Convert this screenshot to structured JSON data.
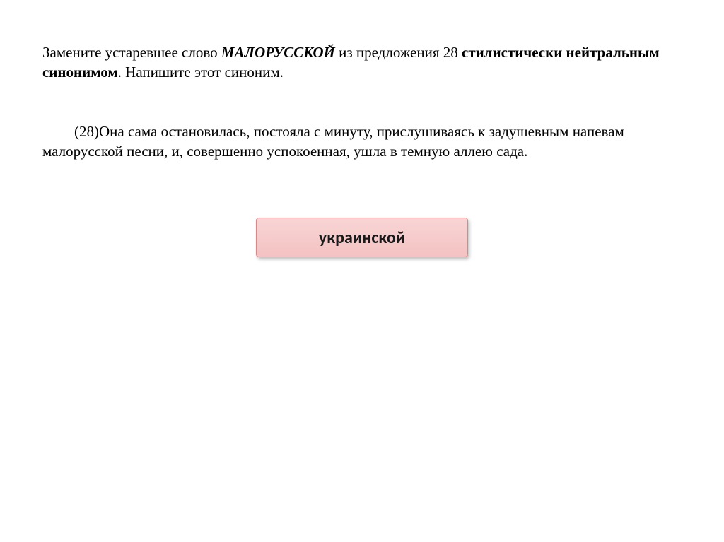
{
  "task": {
    "prefix": "Замените устаревшее слово ",
    "word": "МАЛОРУССКОЙ",
    "middle": " из предложения 28 ",
    "bold_phrase": "стилистически нейтральным синонимом",
    "suffix": ". Напишите этот синоним."
  },
  "sentence": "(28)Она сама остановилась, постояла с минуту, прислушиваясь к задушевным напевам малорусской песни, и, совершенно успокоенная, ушла в темную аллею сада.",
  "answer": "украинской"
}
